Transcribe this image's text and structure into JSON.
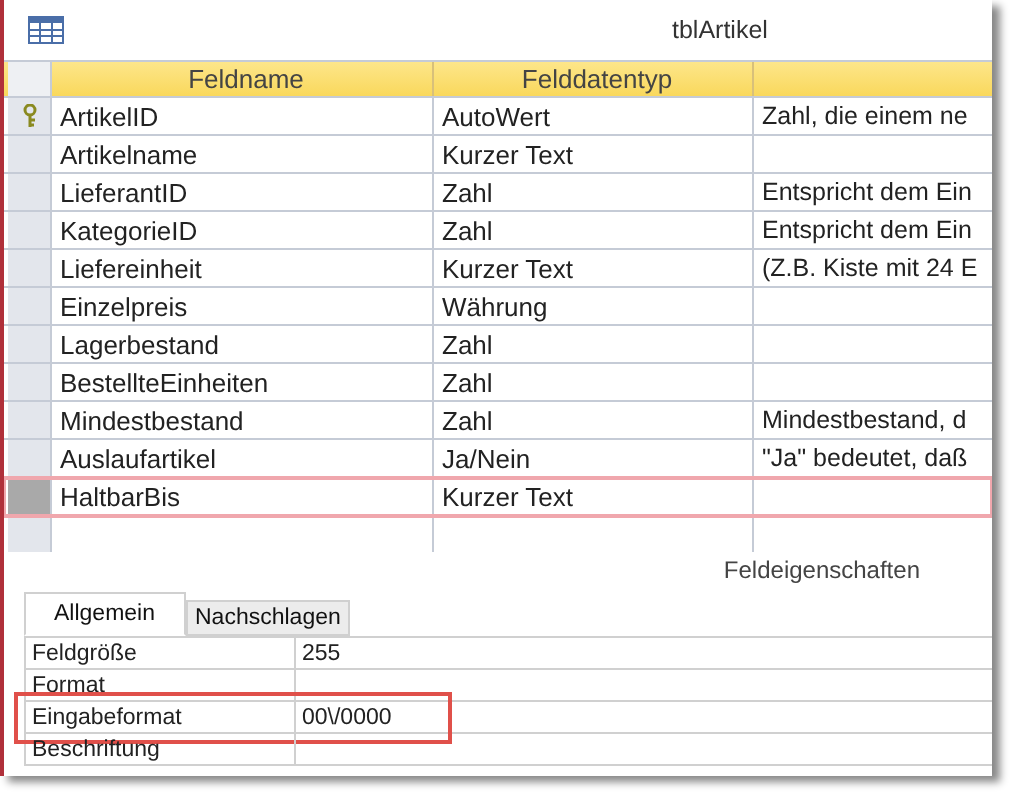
{
  "window": {
    "title": "tblArtikel"
  },
  "table": {
    "columns": [
      "Feldname",
      "Felddatentyp"
    ],
    "rows": [
      {
        "name": "ArtikelID",
        "type": "AutoWert",
        "description": "Zahl, die einem ne",
        "primary_key": true,
        "selected": false
      },
      {
        "name": "Artikelname",
        "type": "Kurzer Text",
        "primary_key": false,
        "selected": false
      },
      {
        "name": "LieferantID",
        "type": "Zahl",
        "description": "Entspricht dem Ein",
        "primary_key": false,
        "selected": false
      },
      {
        "name": "KategorieID",
        "type": "Zahl",
        "description": "Entspricht dem Ein",
        "primary_key": false,
        "selected": false
      },
      {
        "name": "Liefereinheit",
        "type": "Kurzer Text",
        "description": "(Z.B. Kiste mit 24 E",
        "primary_key": false,
        "selected": false
      },
      {
        "name": "Einzelpreis",
        "type": "Währung",
        "primary_key": false,
        "selected": false
      },
      {
        "name": "Lagerbestand",
        "type": "Zahl",
        "primary_key": false,
        "selected": false
      },
      {
        "name": "BestellteEinheiten",
        "type": "Zahl",
        "primary_key": false,
        "selected": false
      },
      {
        "name": "Mindestbestand",
        "type": "Zahl",
        "description": "Mindestbestand, d",
        "primary_key": false,
        "selected": false
      },
      {
        "name": "Auslaufartikel",
        "type": "Ja/Nein",
        "description": "\"Ja\" bedeutet, daß",
        "primary_key": false,
        "selected": false
      },
      {
        "name": "HaltbarBis",
        "type": "Kurzer Text",
        "primary_key": false,
        "selected": true
      }
    ]
  },
  "properties_title": "Feldeigenschaften",
  "tabs": [
    {
      "label": "Allgemein",
      "selected": true
    },
    {
      "label": "Nachschlagen",
      "selected": false
    }
  ],
  "properties": [
    {
      "label": "Feldgröße",
      "value": "255",
      "highlighted": false
    },
    {
      "label": "Format",
      "highlighted": false
    },
    {
      "label": "Eingabeformat",
      "value": "00\\/0000",
      "highlighted": true
    },
    {
      "label": "Beschriftung",
      "highlighted": false
    }
  ]
}
